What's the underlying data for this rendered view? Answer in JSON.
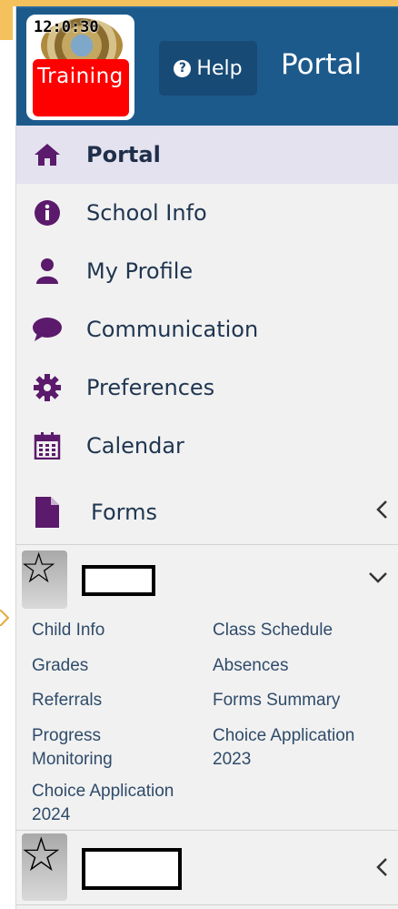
{
  "header": {
    "clock": "12:0:30",
    "training_label": "Training",
    "help_label": "Help",
    "title": "Portal"
  },
  "nav": {
    "items": [
      {
        "label": "Portal",
        "icon": "home-icon",
        "active": true
      },
      {
        "label": "School Info",
        "icon": "info-circle-icon",
        "active": false
      },
      {
        "label": "My Profile",
        "icon": "user-icon",
        "active": false
      },
      {
        "label": "Communication",
        "icon": "chat-bubble-icon",
        "active": false
      },
      {
        "label": "Preferences",
        "icon": "gear-icon",
        "active": false
      },
      {
        "label": "Calendar",
        "icon": "calendar-icon",
        "active": false
      },
      {
        "label": "Forms",
        "icon": "file-icon",
        "active": false
      }
    ]
  },
  "students": [
    {
      "expanded": true,
      "links": [
        "Child Info",
        "Class Schedule",
        "Grades",
        "Absences",
        "Referrals",
        "Forms Summary",
        "Progress Monitoring",
        "Choice Application 2023",
        "Choice Application 2024"
      ]
    },
    {
      "expanded": false,
      "links": []
    }
  ],
  "colors": {
    "header_bg": "#1d5a8c",
    "icon_purple": "#5b1a6b",
    "active_bg": "#e4e2ef",
    "training_red": "#ff0000"
  }
}
